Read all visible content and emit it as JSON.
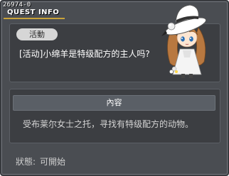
{
  "window": {
    "quest_id": "26974-0",
    "title": "QUEST INFO"
  },
  "quest": {
    "category": "活動",
    "name": "[活动]小绵羊是特级配方的主人吗?"
  },
  "content": {
    "header": "內容",
    "text": "受布莱尔女士之托，寻找有特级配方的动物。"
  },
  "status": {
    "label": "狀態:",
    "value": "可開始"
  },
  "npc": {
    "icon": "npc-girl-with-white-hat-icon"
  }
}
